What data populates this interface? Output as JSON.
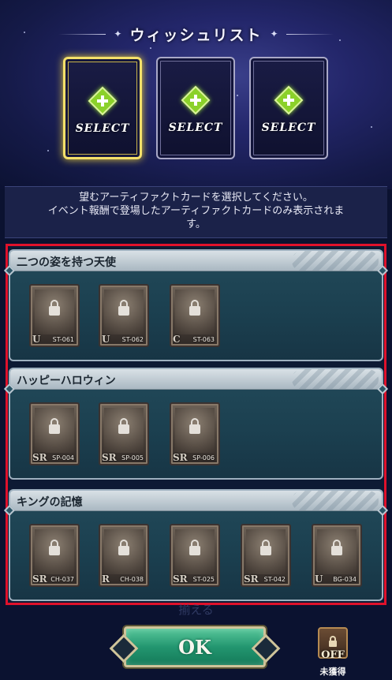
{
  "header": {
    "title": "ウィッシュリスト"
  },
  "select_slots": [
    {
      "label": "SELECT",
      "active": true
    },
    {
      "label": "SELECT",
      "active": false
    },
    {
      "label": "SELECT",
      "active": false
    }
  ],
  "instructions": {
    "line1": "望むアーティファクトカードを選択してください。",
    "line2": "イベント報酬で登場したアーティファクトカードのみ表示されま",
    "line3": "す。"
  },
  "groups": [
    {
      "title": "二つの姿を持つ天使",
      "cards": [
        {
          "rarity": "U",
          "code": "ST-061",
          "locked": true
        },
        {
          "rarity": "U",
          "code": "ST-062",
          "locked": true
        },
        {
          "rarity": "C",
          "code": "ST-063",
          "locked": true
        }
      ]
    },
    {
      "title": "ハッピーハロウィン",
      "cards": [
        {
          "rarity": "SR",
          "code": "SP-004",
          "locked": true
        },
        {
          "rarity": "SR",
          "code": "SP-005",
          "locked": true
        },
        {
          "rarity": "SR",
          "code": "SP-006",
          "locked": true
        }
      ]
    },
    {
      "title": "キングの記憶",
      "cards": [
        {
          "rarity": "SR",
          "code": "CH-037",
          "locked": true
        },
        {
          "rarity": "R",
          "code": "CH-038",
          "locked": true
        },
        {
          "rarity": "SR",
          "code": "ST-025",
          "locked": true
        },
        {
          "rarity": "SR",
          "code": "ST-042",
          "locked": true
        },
        {
          "rarity": "U",
          "code": "BG-034",
          "locked": true
        }
      ]
    }
  ],
  "footer": {
    "partial_text": "揃える",
    "ok_label": "OK",
    "filter_state": "OFF",
    "filter_caption": "未獲得"
  },
  "colors": {
    "highlight_frame": "#e0112b",
    "active_slot_border": "#f5e06a",
    "plus_icon": "#8bd12a",
    "ok_button": "#239670"
  },
  "icons": [
    "plus-icon",
    "lock-icon",
    "book-lock-icon"
  ]
}
